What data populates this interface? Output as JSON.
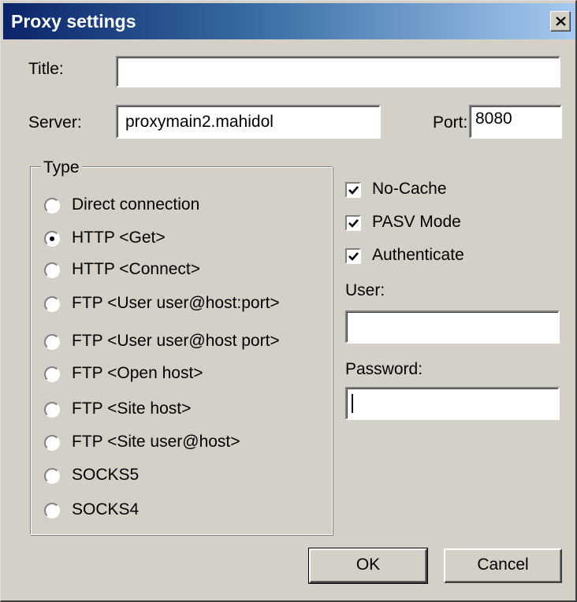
{
  "window": {
    "title": "Proxy settings"
  },
  "form": {
    "title_label": "Title:",
    "title_value": "",
    "server_label": "Server:",
    "server_value": "proxymain2.mahidol",
    "port_label": "Port:",
    "port_value": "8080"
  },
  "type_group": {
    "legend": "Type",
    "selected": "HTTP <Get>",
    "options": [
      "Direct connection",
      "HTTP <Get>",
      "HTTP <Connect>",
      "FTP <User user@host:port>",
      "FTP <User user@host port>",
      "FTP <Open host>",
      "FTP <Site host>",
      "FTP <Site user@host>",
      "SOCKS5",
      "SOCKS4"
    ]
  },
  "options": {
    "no_cache": {
      "label": "No-Cache",
      "checked": true
    },
    "pasv_mode": {
      "label": "PASV Mode",
      "checked": true
    },
    "authenticate": {
      "label": "Authenticate",
      "checked": true
    }
  },
  "credentials": {
    "user_label": "User:",
    "user_value": "",
    "password_label": "Password:",
    "password_value": ""
  },
  "buttons": {
    "ok": "OK",
    "cancel": "Cancel"
  },
  "icons": {
    "close": "close-icon",
    "check": "check-icon",
    "radio": "radio-dot-icon"
  }
}
